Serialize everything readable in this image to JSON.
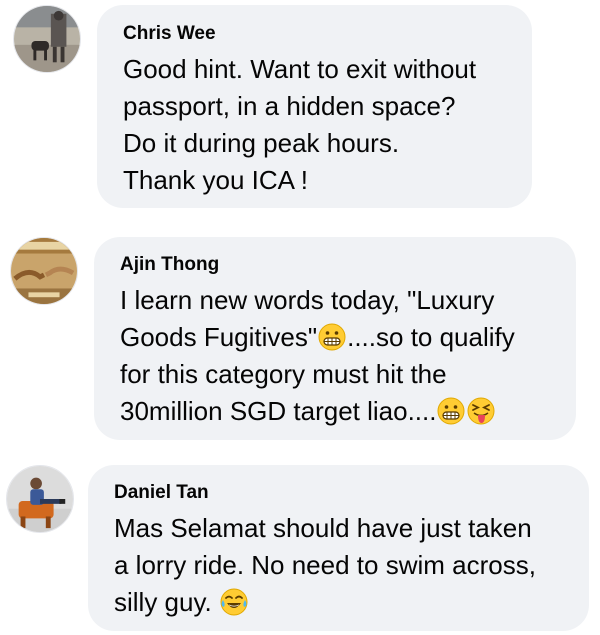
{
  "comments": [
    {
      "author": "Chris Wee",
      "lines": [
        "Good hint. Want to exit without",
        "passport, in a hidden space?",
        "Do it during peak hours.",
        "Thank you ICA !"
      ]
    },
    {
      "author": "Ajin Thong",
      "line1": "I learn new words today, \"Luxury",
      "line2_before": "Goods Fugitives\"",
      "line2_after": "....so to qualify",
      "line3": "for this category must hit the",
      "line4_before": "30million SGD target liao....",
      "emojis": [
        "grimacing-face-emoji",
        "squinting-face-with-tongue-emoji"
      ]
    },
    {
      "author": "Daniel Tan",
      "lines": [
        "Mas Selamat should have just taken",
        "a lorry ride. No need to swim across,"
      ],
      "line3_before": "silly guy. ",
      "emojis": [
        "tears-of-joy-emoji"
      ]
    }
  ],
  "colors": {
    "bubble": "#f0f2f5",
    "text": "#050505",
    "emoji_yellow": "#ffcc33"
  }
}
